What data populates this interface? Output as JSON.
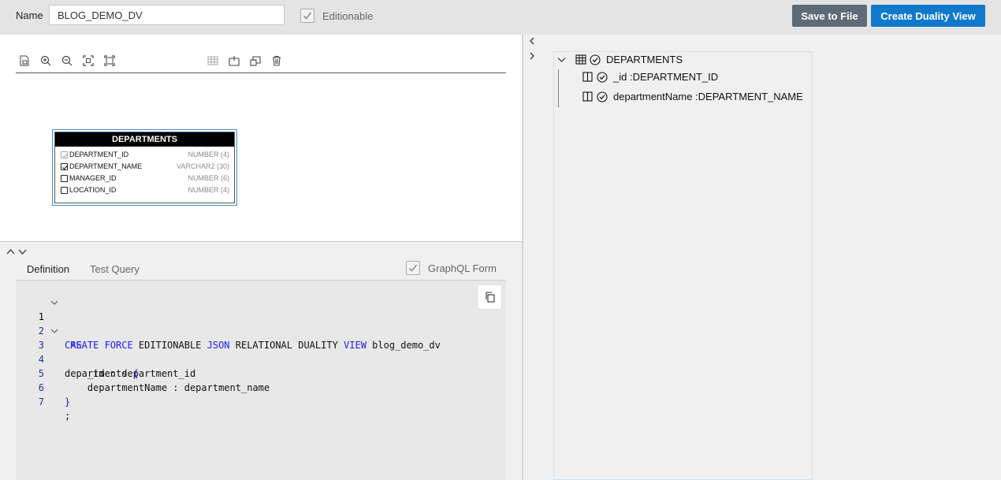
{
  "header": {
    "name_label": "Name",
    "name_value": "BLOG_DEMO_DV",
    "editionable_label": "Editionable",
    "editionable_checked": true,
    "save_button": "Save to File",
    "create_button": "Create Duality View"
  },
  "diagram": {
    "toolbar_icons": [
      "page-icon",
      "zoom-in-icon",
      "zoom-out-icon",
      "fit-icon",
      "actual-size-icon",
      "table-icon",
      "add-icon",
      "copy-object-icon",
      "trash-icon"
    ],
    "entity": {
      "title": "DEPARTMENTS",
      "columns": [
        {
          "name": "DEPARTMENT_ID",
          "type": "NUMBER (4)",
          "checked": true,
          "disabled": true
        },
        {
          "name": "DEPARTMENT_NAME",
          "type": "VARCHAR2 (30)",
          "checked": true,
          "disabled": false
        },
        {
          "name": "MANAGER_ID",
          "type": "NUMBER (6)",
          "checked": false,
          "disabled": false
        },
        {
          "name": "LOCATION_ID",
          "type": "NUMBER (4)",
          "checked": false,
          "disabled": false
        }
      ]
    }
  },
  "tabs": {
    "definition": "Definition",
    "test_query": "Test Query",
    "graphql_label": "GraphQL Form",
    "graphql_checked": true
  },
  "editor": {
    "lines": [
      {
        "n": "1",
        "text": "CREATE FORCE EDITIONABLE JSON RELATIONAL DUALITY VIEW blog_demo_dv"
      },
      {
        "n": "2",
        "text": " AS"
      },
      {
        "n": "3",
        "text": "departments {"
      },
      {
        "n": "4",
        "text": "    _id : department_id"
      },
      {
        "n": "5",
        "text": "    departmentName : department_name"
      },
      {
        "n": "6",
        "text": "}"
      },
      {
        "n": "7",
        "text": ";"
      }
    ]
  },
  "tree": {
    "root": "DEPARTMENTS",
    "children": [
      "_id :DEPARTMENT_ID",
      "departmentName :DEPARTMENT_NAME"
    ]
  },
  "colors": {
    "primary_button": "#1179cc",
    "secondary_button": "#5e6a77",
    "keyword": "#1a1aff",
    "selection_border": "#3a8fd6"
  }
}
